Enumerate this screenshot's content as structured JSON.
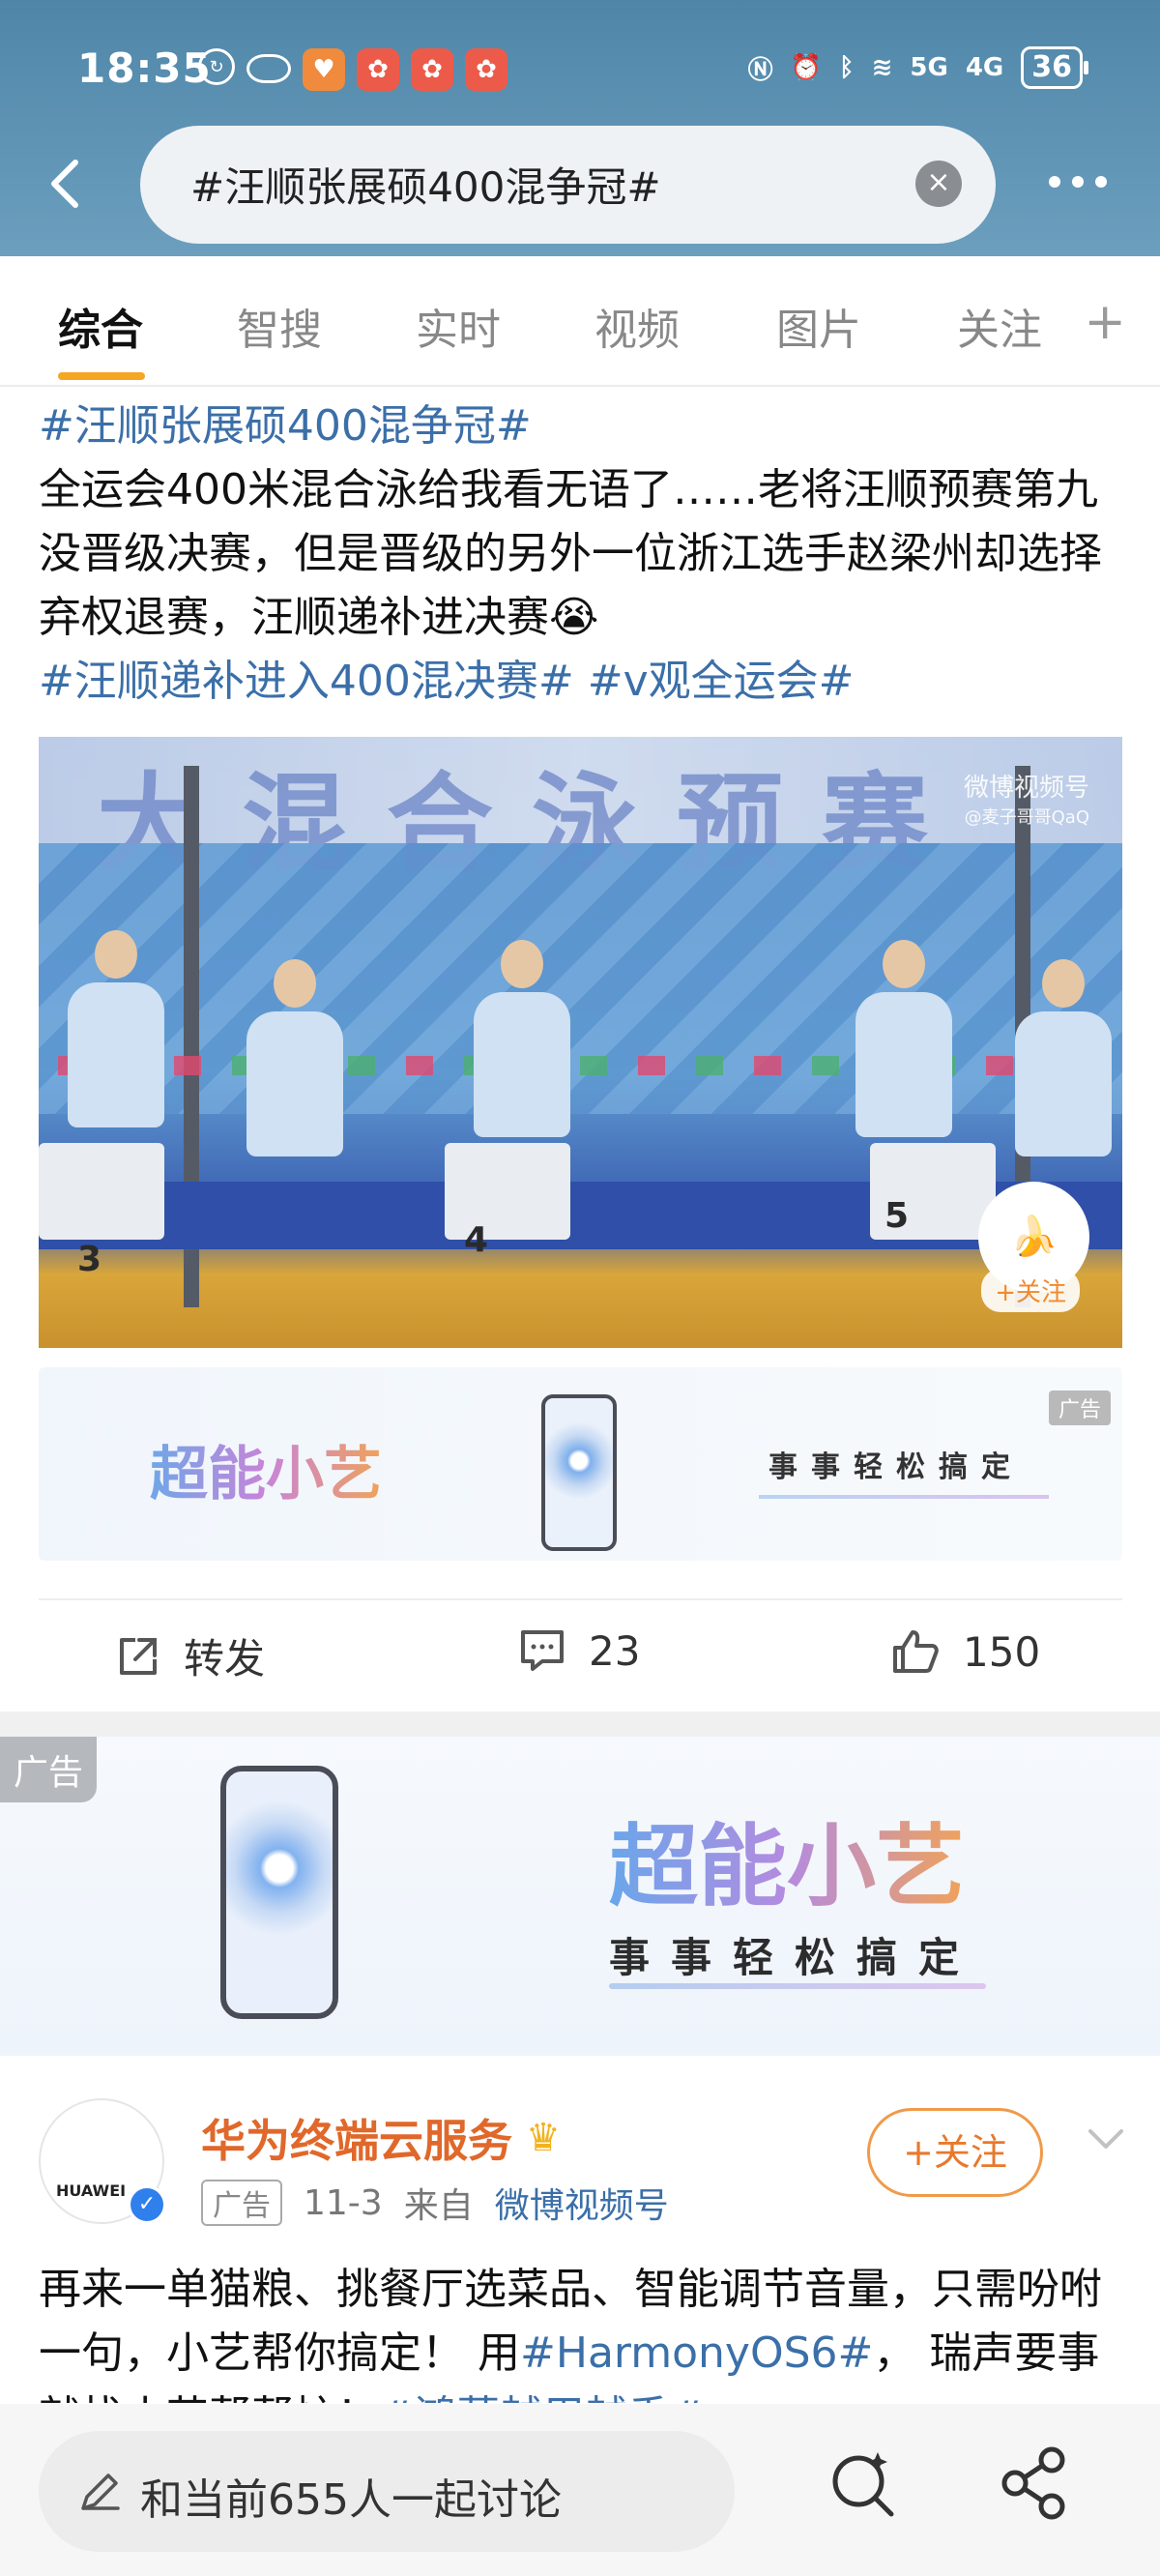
{
  "status": {
    "time": "18:35",
    "battery": "36",
    "signal_1": "5G",
    "signal_2": "4G"
  },
  "search": {
    "query": "#汪顺张展硕400混争冠#"
  },
  "tabs": [
    {
      "label": "综合"
    },
    {
      "label": "智搜"
    },
    {
      "label": "实时"
    },
    {
      "label": "视频"
    },
    {
      "label": "图片"
    },
    {
      "label": "关注"
    }
  ],
  "post": {
    "hashtag_top": "#汪顺张展硕400混争冠#",
    "body": "全运会400米混合泳给我看无语了……老将汪顺预赛第九没晋级决赛，但是晋级的另外一位浙江选手赵梁州却选择弃权退赛，汪顺递补进决赛",
    "emoji": "😭",
    "hashtag_a": "#汪顺递补进入400混决赛#",
    "hashtag_b": "#v观全运会#",
    "video_banner_text": "大混合泳预赛",
    "watermark": "微博视频号",
    "watermark_handle": "@麦子哥哥QaQ",
    "follow_badge_label": "+关注",
    "lane_numbers": [
      "3",
      "4",
      "5"
    ],
    "repost_label": "转发",
    "comment_count": "23",
    "like_count": "150"
  },
  "inline_ad": {
    "brand": "超能小艺",
    "slogan": "事事轻松搞定",
    "tag": "广告"
  },
  "big_ad": {
    "tag": "广告",
    "brand": "超能小艺",
    "slogan": "事事轻松搞定"
  },
  "account_post": {
    "avatar_text": "HUAWEI",
    "name": "华为终端云服务",
    "ad_tag": "广告",
    "date": "11-3",
    "from_label": "来自",
    "source": "微博视频号",
    "follow_label": "+关注",
    "body_1": "再来一单猫粮、挑餐厅选菜品、智能调节音量，只需吩咐一句，小艺帮你搞定！ 用",
    "body_hashtag": "#HarmonyOS6#",
    "body_2": "，",
    "body_3": "瑞声要事就找小艺帮帮忙！",
    "body_hashtag_2": "#鸿蒙越用越香#"
  },
  "bottom_bar": {
    "discuss_placeholder": "和当前655人一起讨论"
  },
  "colors": {
    "accent": "#f5a623",
    "hashtag": "#3b6fa8",
    "account_name": "#e0682a"
  }
}
